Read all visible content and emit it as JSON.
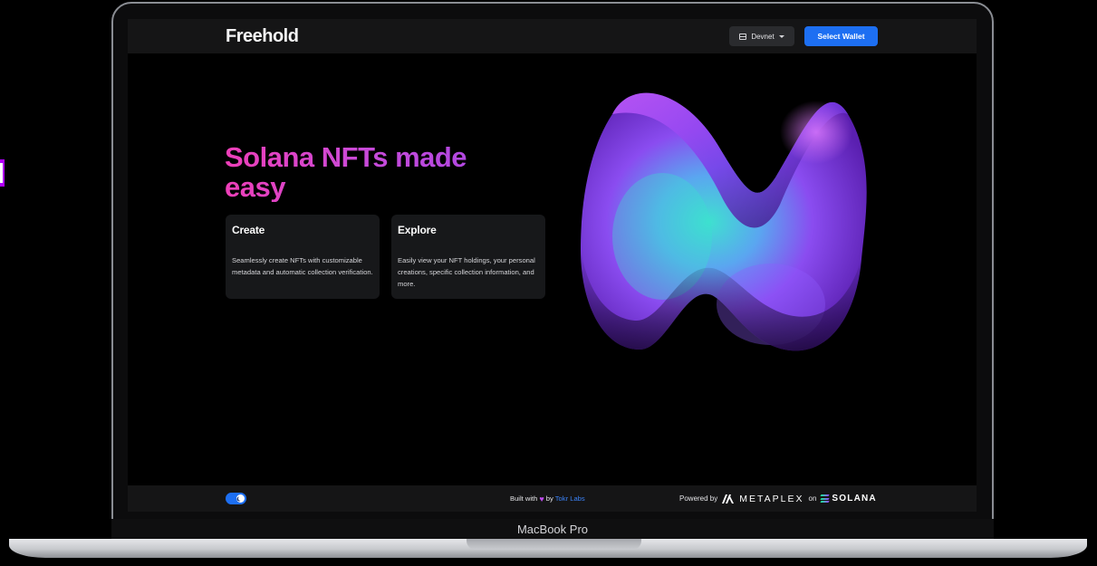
{
  "header": {
    "brand": "Freehold",
    "network_label": "Devnet",
    "wallet_button": "Select Wallet"
  },
  "hero": {
    "title": "Solana NFTs made easy"
  },
  "cards": [
    {
      "title": "Create",
      "text": "Seamlessly create NFTs with customizable metadata and automatic collection verification."
    },
    {
      "title": "Explore",
      "text": "Easily view your NFT holdings, your personal creations, specific collection information, and more."
    }
  ],
  "footer": {
    "built_prefix": "Built with",
    "built_by": "by",
    "built_company": "Tokr Labs",
    "powered_by": "Powered by",
    "metaplex": "METAPLEX",
    "on": "on",
    "solana": "SOLANA"
  },
  "device": {
    "label": "MacBook Pro"
  },
  "icons": {
    "network": "server-icon",
    "dropdown": "caret-down-icon",
    "theme_toggle": "moon-icon",
    "heart": "heart-icon",
    "metaplex_logo": "metaplex-icon",
    "solana_logo": "solana-icon"
  },
  "colors": {
    "accent_blue": "#1d6ff2",
    "hero_gradient_start": "#ee3fb8",
    "hero_gradient_end": "#a446e6",
    "heart": "#c04bf0",
    "tokr_link": "#3b82f6"
  }
}
